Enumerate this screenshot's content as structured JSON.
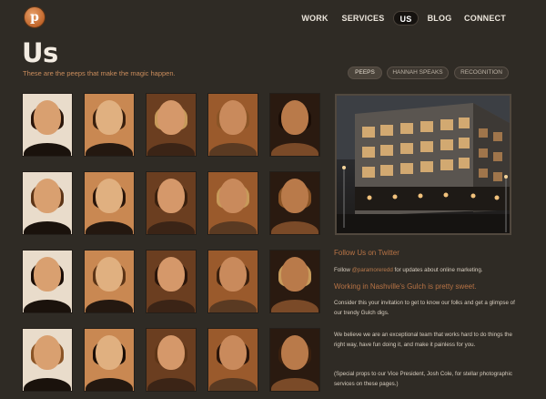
{
  "nav": {
    "items": [
      {
        "label": "WORK",
        "active": false
      },
      {
        "label": "SERVICES",
        "active": false
      },
      {
        "label": "US",
        "active": true
      },
      {
        "label": "BLOG",
        "active": false
      },
      {
        "label": "CONNECT",
        "active": false
      }
    ]
  },
  "header": {
    "logo_letter": "p",
    "title": "Us",
    "subtitle": "These are the peeps that make the magic happen."
  },
  "filters": [
    {
      "label": "PEEPS",
      "active": true
    },
    {
      "label": "HANNAH SPEAKS",
      "active": false
    },
    {
      "label": "RECOGNITION",
      "active": false
    }
  ],
  "team_photos": {
    "count": 20,
    "columns": 5,
    "rows": 4
  },
  "sidebar": {
    "twitter_heading": "Follow Us on Twitter",
    "twitter_prefix": "Follow ",
    "twitter_handle": "@paramoreredd",
    "twitter_suffix": " for updates about online marketing.",
    "gulch_heading": "Working in Nashville's Gulch is pretty sweet.",
    "gulch_text": "Consider this your invitation to get to know our folks and get a glimpse of our trendy Gulch digs.",
    "belief_text": "We believe we are an exceptional team that works hard to do things the right way, have fun doing it, and make it painless for you.",
    "props_text": "(Special props to our Vice President, Josh Cole, for stellar photographic services on these pages.)"
  },
  "colors": {
    "background": "#2f2b25",
    "accent_orange": "#b87345",
    "nav_active_bg": "#15120f",
    "text": "#d8cfc2"
  }
}
